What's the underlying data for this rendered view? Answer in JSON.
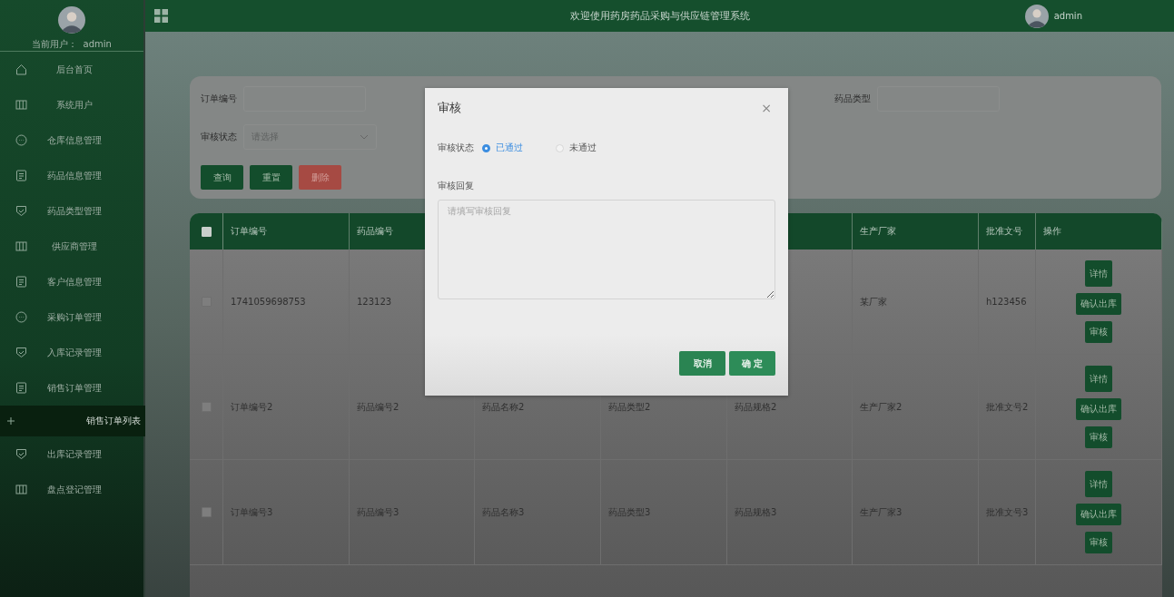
{
  "topbar": {
    "title": "欢迎使用药房药品采购与供应链管理系统",
    "user": "admin"
  },
  "sidebar": {
    "current_user": "当前用户：  admin",
    "items": [
      {
        "label": "后台首页",
        "kind": "home",
        "selected": false
      },
      {
        "label": "系统用户",
        "kind": "columns",
        "selected": false
      },
      {
        "label": "仓库信息管理",
        "kind": "chat",
        "selected": false
      },
      {
        "label": "药品信息管理",
        "kind": "doc",
        "selected": false
      },
      {
        "label": "药品类型管理",
        "kind": "shield",
        "selected": false
      },
      {
        "label": "供应商管理",
        "kind": "columns",
        "selected": false
      },
      {
        "label": "客户信息管理",
        "kind": "doc",
        "selected": false
      },
      {
        "label": "采购订单管理",
        "kind": "chat",
        "selected": false
      },
      {
        "label": "入库记录管理",
        "kind": "shield",
        "selected": false
      },
      {
        "label": "销售订单管理",
        "kind": "doc",
        "selected": false,
        "children": [
          {
            "label": "销售订单列表",
            "selected": true
          }
        ]
      },
      {
        "label": "出库记录管理",
        "kind": "shield",
        "selected": false
      },
      {
        "label": "盘点登记管理",
        "kind": "columns",
        "selected": false
      }
    ]
  },
  "search": {
    "fields": [
      {
        "label": "订单编号",
        "kind": "input"
      },
      {
        "label": "药品类型",
        "kind": "input"
      },
      {
        "label": "审核状态",
        "kind": "select",
        "placeholder": "请选择"
      }
    ],
    "buttons": [
      {
        "label": "查询",
        "kind": "primary"
      },
      {
        "label": "重置",
        "kind": "primary"
      },
      {
        "label": "删除",
        "kind": "danger"
      }
    ]
  },
  "table": {
    "all_checked": false,
    "columns": [
      "订单编号",
      "药品编号",
      null,
      null,
      null,
      "生产厂家",
      "批准文号",
      "操作"
    ],
    "rows": [
      {
        "checked": false,
        "cells": [
          "1741059698753",
          "123123",
          null,
          null,
          null,
          "某厂家",
          "h123456"
        ],
        "actions": [
          "详情",
          "确认出库",
          "审核"
        ]
      },
      {
        "checked": false,
        "cells": [
          "订单编号2",
          "药品编号2",
          "药品名称2",
          "药品类型2",
          "药品规格2",
          "生产厂家2",
          "批准文号2"
        ],
        "actions": [
          "详情",
          "确认出库",
          "审核"
        ]
      },
      {
        "checked": false,
        "cells": [
          "订单编号3",
          "药品编号3",
          "药品名称3",
          "药品类型3",
          "药品规格3",
          "生产厂家3",
          "批准文号3"
        ],
        "actions": [
          "详情",
          "确认出库",
          "审核"
        ]
      }
    ]
  },
  "dialog": {
    "title": "审核",
    "close": "×",
    "status_label": "审核状态",
    "options": [
      {
        "label": "已通过",
        "selected": true
      },
      {
        "label": "未通过",
        "selected": false
      }
    ],
    "reply_label": "审核回复",
    "reply_placeholder": "请填写审核回复",
    "buttons": [
      {
        "label": "取消",
        "kind": "cancel"
      },
      {
        "label": "确 定",
        "kind": "confirm"
      }
    ]
  }
}
